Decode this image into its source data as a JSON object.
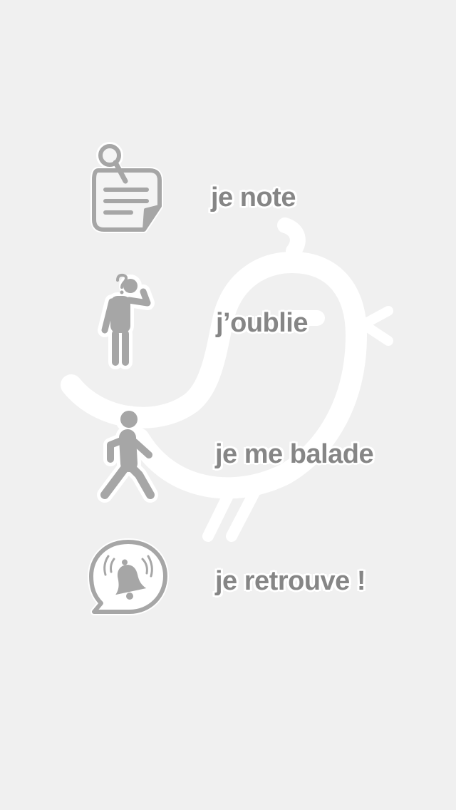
{
  "steps": [
    {
      "label": "je note",
      "icon": "notepad-pin-icon"
    },
    {
      "label": "j’oublie",
      "icon": "thinking-person-icon"
    },
    {
      "label": "je me balade",
      "icon": "walking-person-icon"
    },
    {
      "label": "je retrouve !",
      "icon": "bell-speech-bubble-icon"
    }
  ],
  "background_icon": "bird-outline-icon",
  "colors": {
    "background": "#f0f0f0",
    "text": "#868686",
    "icon": "#a6a6a6",
    "outline": "#ffffff"
  }
}
